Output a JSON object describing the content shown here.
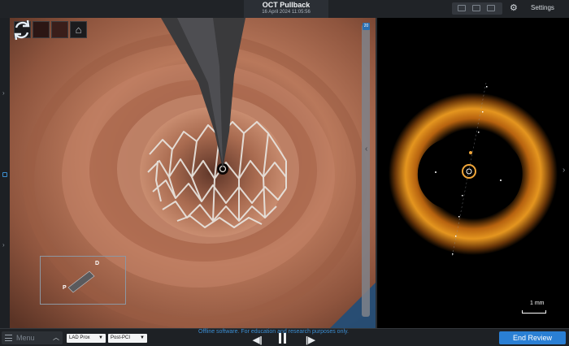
{
  "header": {
    "title": "OCT Pullback",
    "timestamp": "16 April 2024 11:05:56",
    "settings_label": "Settings"
  },
  "view3d": {
    "orientation": {
      "distal_label": "D",
      "proximal_label": "P"
    },
    "scroll_indicator": "20"
  },
  "oct": {
    "scale_label": "1 mm"
  },
  "footer": {
    "menu_label": "Menu",
    "vessel_select": "LAD Prox",
    "phase_select": "Post-PCI",
    "disclaimer": "Offline software. For education and research purposes only.",
    "end_review_label": "End Review"
  },
  "colors": {
    "accent_blue": "#2a7fd4",
    "disclaimer_blue": "#3b8ed3",
    "vessel_wall": "#b77458",
    "oct_orange": "#d98a1c"
  },
  "icons": [
    "settings-gear-icon",
    "home-icon",
    "sync-icon",
    "menu-icon",
    "previous-frame-icon",
    "pause-icon",
    "next-frame-icon"
  ]
}
